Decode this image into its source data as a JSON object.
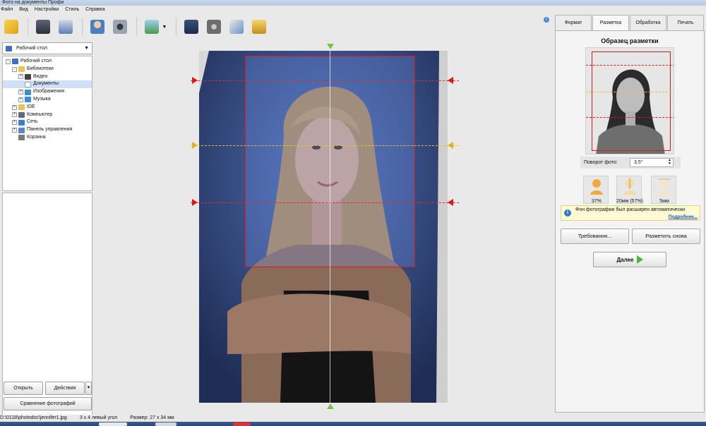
{
  "window": {
    "title": "Фото на документы Профи"
  },
  "menu": [
    "Файл",
    "Вид",
    "Настройки",
    "Стиль",
    "Справка"
  ],
  "toolbar": {
    "icons": [
      "open-icon",
      "save-icon",
      "print-icon",
      "user-photo-icon",
      "camera-icon",
      "image-edit-icon",
      "help-book-icon",
      "film-icon",
      "tag-icon",
      "cart-icon"
    ]
  },
  "folder_combo": {
    "value": "Рабочий стол"
  },
  "tree": {
    "items": [
      {
        "label": "Рабочий стол",
        "level": 0,
        "expander": "-"
      },
      {
        "label": "Библиотеки",
        "level": 1,
        "expander": "-"
      },
      {
        "label": "Видео",
        "level": 2,
        "expander": "+"
      },
      {
        "label": "Документы",
        "level": 2,
        "expander": "",
        "selected": true
      },
      {
        "label": "Изображения",
        "level": 2,
        "expander": "+"
      },
      {
        "label": "Музыка",
        "level": 2,
        "expander": "+"
      },
      {
        "label": "IDE",
        "level": 1,
        "expander": "+"
      },
      {
        "label": "Компьютер",
        "level": 1,
        "expander": "+"
      },
      {
        "label": "Сеть",
        "level": 1,
        "expander": "+"
      },
      {
        "label": "Панель управления",
        "level": 1,
        "expander": "+"
      },
      {
        "label": "Корзина",
        "level": 1,
        "expander": ""
      }
    ]
  },
  "left_buttons": {
    "open": "Открыть",
    "actions": "Действия",
    "compare": "Сравнение фотографий"
  },
  "tabs": [
    "Формат",
    "Разметка",
    "Обработка",
    "Печать"
  ],
  "active_tab": "Разметка",
  "markup": {
    "title": "Образец разметки",
    "rotation_label": "Поворот фото:",
    "rotation_value": "3,5°",
    "minis": [
      {
        "label": "37%",
        "icon": "head-size-icon"
      },
      {
        "label": "20мм (57%)",
        "icon": "head-height-icon"
      },
      {
        "label": "5мм",
        "icon": "top-margin-icon"
      }
    ],
    "notice": {
      "text": "Фон фотографии был расширен автоматически",
      "link": "Подробнее..."
    },
    "requirements_button": "Требования...",
    "remark_button": "Разметить снова",
    "next_button": "Далее"
  },
  "status": {
    "path": "D:\\0118\\photodoc\\jennifer1.jpg",
    "format": "3 x 4 левый угол",
    "size": "Размер: 27 x 34 мм"
  },
  "colors": {
    "crop": "#e0161b",
    "eye_line": "#e7c321",
    "accent": "#4fb43a",
    "notice_bg": "#fdfbd4"
  }
}
